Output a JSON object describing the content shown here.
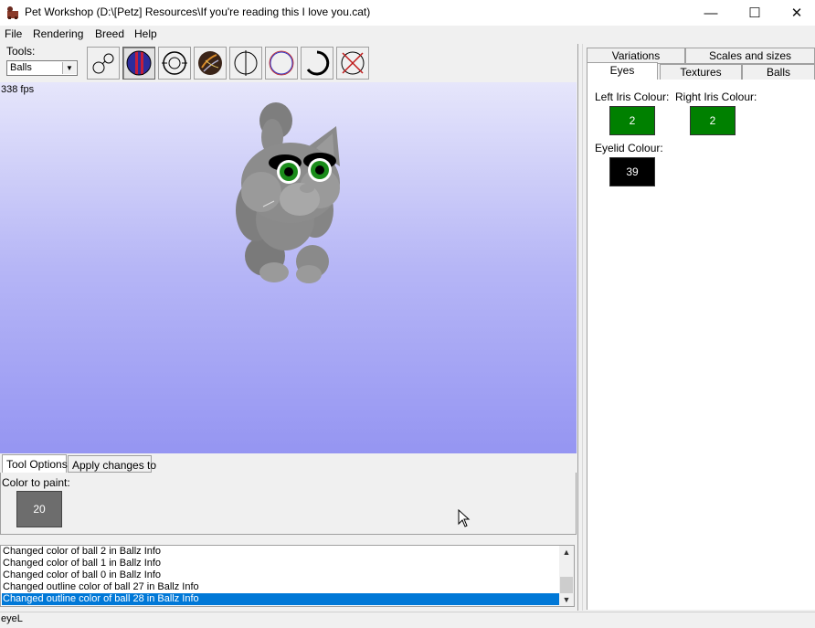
{
  "window": {
    "title": "Pet Workshop (D:\\[Petz] Resources\\If you're reading this I love you.cat)",
    "minimize_glyph": "—",
    "maximize_glyph": "☐",
    "close_glyph": "✕"
  },
  "menu": [
    "File",
    "Rendering",
    "Breed",
    "Help"
  ],
  "tools": {
    "label": "Tools:",
    "selected": "Balls",
    "buttons": [
      "move-balls-icon",
      "paint-color-icon",
      "rotate-view-icon",
      "texture-icon",
      "split-half-icon",
      "outline-circle-icon",
      "thick-outline-icon",
      "delete-icon"
    ]
  },
  "viewport": {
    "fps": "338 fps"
  },
  "bottom_tabs": [
    "Tool Options",
    "Apply changes to"
  ],
  "tool_options": {
    "color_label": "Color to paint:",
    "color_value": "20",
    "color_hex": "#6d6d6d"
  },
  "log": [
    "Changed color of ball 2 in Ballz Info",
    "Changed color of ball 1 in Ballz Info",
    "Changed color of ball 0 in Ballz Info",
    "Changed outline color of ball 27 in Ballz Info",
    "Changed outline color of ball 28 in Ballz Info"
  ],
  "status": "eyeL",
  "right_tabs": {
    "row1": [
      "Variations",
      "Scales and sizes"
    ],
    "row2": [
      "Eyes",
      "Textures",
      "Balls"
    ]
  },
  "eyes": {
    "left_iris_label": "Left Iris Colour:",
    "left_iris_value": "2",
    "right_iris_label": "Right Iris Colour:",
    "right_iris_value": "2",
    "eyelid_label": "Eyelid Colour:",
    "eyelid_value": "39",
    "iris_color_hex": "#008000",
    "eyelid_color_hex": "#000000"
  }
}
